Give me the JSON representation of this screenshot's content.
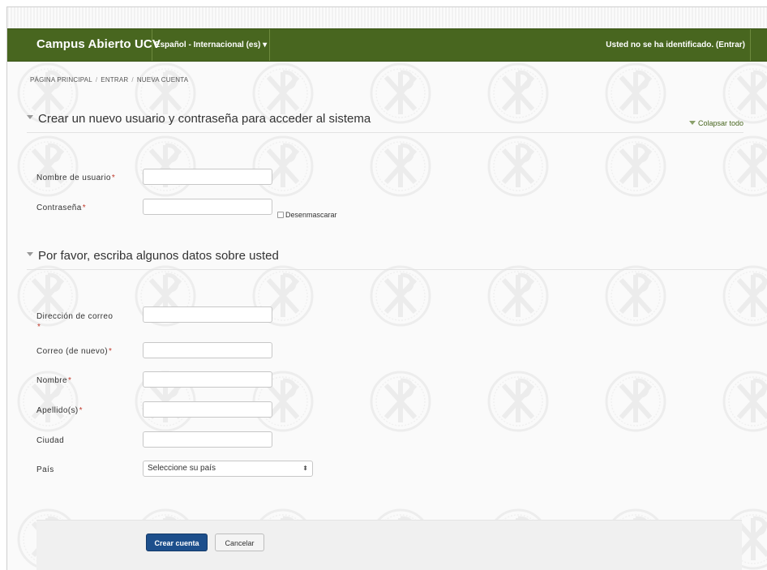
{
  "navbar": {
    "brand": "Campus Abierto UCV",
    "language": "Español - Internacional (es)",
    "login_status": "Usted no se ha identificado. (Entrar)"
  },
  "breadcrumb": [
    "PÁGINA PRINCIPAL",
    "ENTRAR",
    "NUEVA CUENTA"
  ],
  "collapse_all": "Colapsar todo",
  "section1": {
    "title": "Crear un nuevo usuario y contraseña para acceder al sistema",
    "username_label": "Nombre de usuario",
    "password_label": "Contraseña",
    "unmask_label": "Desenmascarar"
  },
  "section2": {
    "title": "Por favor, escriba algunos datos sobre usted",
    "email_label": "Dirección de correo",
    "email2_label": "Correo (de nuevo)",
    "firstname_label": "Nombre",
    "lastname_label": "Apellido(s)",
    "city_label": "Ciudad",
    "country_label": "País",
    "country_selected": "Seleccione su país"
  },
  "required_mark": "*",
  "buttons": {
    "create": "Crear cuenta",
    "cancel": "Cancelar"
  },
  "colors": {
    "navbar": "#48661f",
    "primary_button": "#1d4f8c",
    "required": "#c0392b"
  }
}
